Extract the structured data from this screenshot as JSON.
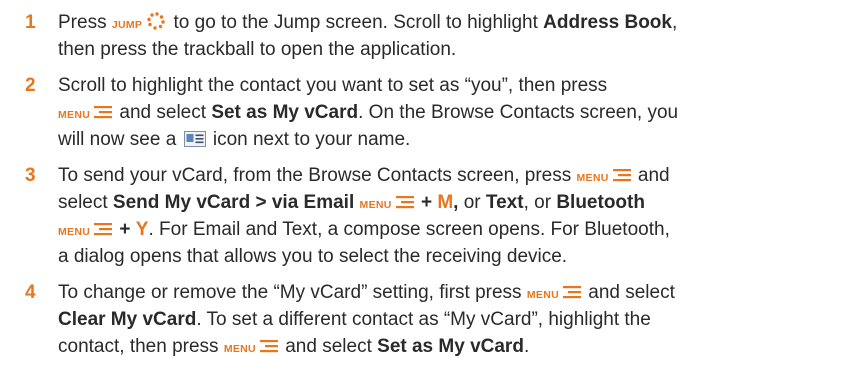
{
  "colors": {
    "accent": "#e8761e",
    "text": "#2a2a2a"
  },
  "keys": {
    "jump": "JUMP",
    "menu": "MENU"
  },
  "icons": {
    "jump": "jump-dots-icon",
    "menu": "menu-lines-icon",
    "vcard": "vcard-icon"
  },
  "steps": [
    {
      "num": "1",
      "l1": {
        "a": "Press",
        "b": "to go to the Jump screen. Scroll to highlight",
        "c": "Address Book",
        "d": ","
      },
      "l2": {
        "a": "then press the trackball to open the application."
      }
    },
    {
      "num": "2",
      "l1": {
        "a": "Scroll to highlight the contact you want to set as “you”, then press"
      },
      "l2": {
        "a": "and select",
        "b": "Set as My vCard",
        "c": ". On the Browse Contacts screen, you"
      },
      "l3": {
        "a": "will now see a",
        "b": "icon next to your name."
      }
    },
    {
      "num": "3",
      "l1": {
        "a": "To send your vCard, from the Browse Contacts screen, press",
        "b": "and"
      },
      "l2": {
        "a": "select",
        "b": "Send My vCard",
        "c": ">",
        "d": "via Email",
        "e": "+",
        "f": "M",
        "g": ",",
        "h": "or",
        "i": "Text",
        "j": ", or",
        "k": "Bluetooth"
      },
      "l3": {
        "a": "+",
        "b": "Y",
        "c": ". For Email and Text, a compose screen opens. For Bluetooth,"
      },
      "l4": {
        "a": "a dialog opens that allows you to select the receiving device."
      }
    },
    {
      "num": "4",
      "l1": {
        "a": "To change or remove the “My vCard” setting, first press",
        "b": "and select"
      },
      "l2": {
        "a": "Clear My vCard",
        "b": ". To set a different contact as “My vCard”, highlight the"
      },
      "l3": {
        "a": "contact, then press",
        "b": "and select",
        "c": "Set as My vCard",
        "d": "."
      }
    }
  ]
}
